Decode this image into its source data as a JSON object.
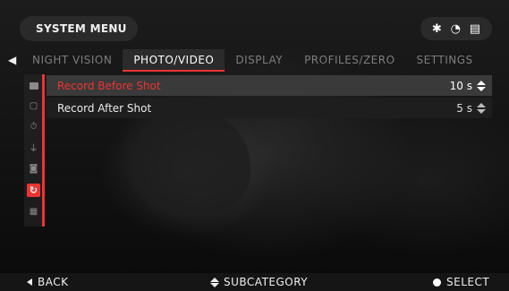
{
  "header": {
    "title": "SYSTEM MENU",
    "status_icons": {
      "bluetooth": "✱",
      "wifi": "◔",
      "sd_card": "▤"
    }
  },
  "nav": {
    "back_glyph": "◀",
    "tabs": [
      {
        "label": "NIGHT VISION"
      },
      {
        "label": "PHOTO/VIDEO"
      },
      {
        "label": "DISPLAY"
      },
      {
        "label": "PROFILES/ZERO"
      },
      {
        "label": "SETTINGS"
      }
    ],
    "active_tab": "PHOTO/VIDEO"
  },
  "sidebar": {
    "icons": [
      {
        "name": "camera-icon",
        "glyph": ""
      },
      {
        "name": "gallery-icon",
        "glyph": "▢"
      },
      {
        "name": "timer-icon",
        "glyph": "⏱"
      },
      {
        "name": "microphone-icon",
        "glyph": "⏚"
      },
      {
        "name": "settings-box-icon",
        "glyph": "◙"
      },
      {
        "name": "recoil-activated-video-icon",
        "glyph": "↻"
      },
      {
        "name": "calendar-icon",
        "glyph": "▦"
      }
    ],
    "active_index": 5
  },
  "settings": [
    {
      "label": "Record Before Shot",
      "value": "10 s"
    },
    {
      "label": "Record After Shot",
      "value": "5 s"
    }
  ],
  "footer": {
    "back_label": "BACK",
    "subcategory_label": "SUBCATEGORY",
    "select_label": "SELECT"
  },
  "colors": {
    "accent": "#e33333",
    "panel": "#2a2a2a",
    "background": "#000000"
  }
}
